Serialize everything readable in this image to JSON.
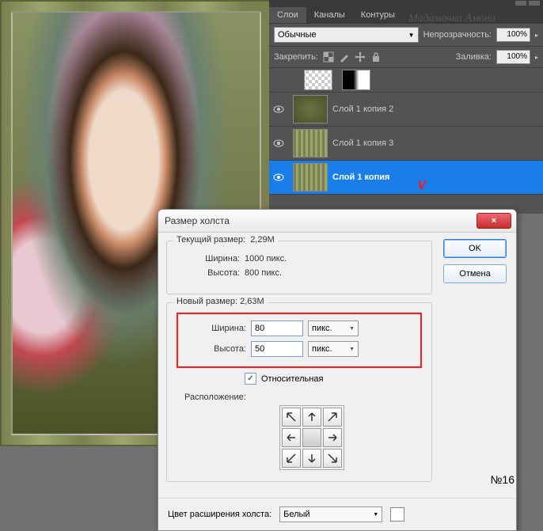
{
  "layers_panel": {
    "tabs": [
      "Слои",
      "Каналы",
      "Контуры"
    ],
    "blend_mode": "Обычные",
    "opacity_label": "Непрозрачность:",
    "opacity_value": "100%",
    "lock_label": "Закрепить:",
    "fill_label": "Заливка:",
    "fill_value": "100%",
    "layers": [
      {
        "name": "",
        "thumb": "checker"
      },
      {
        "name": "Слой 1 копия 2",
        "thumb": "stripes"
      },
      {
        "name": "Слой 1 копия 3",
        "thumb": "stripes"
      },
      {
        "name": "Слой 1 копия",
        "thumb": "stripes",
        "selected": true
      }
    ],
    "red_annotation": "V"
  },
  "dialog": {
    "title": "Размер холста",
    "close": "×",
    "current_group": "Текущий размер:",
    "current_size": "2,29M",
    "width_label": "Ширина:",
    "current_width": "1000 пикс.",
    "height_label": "Высота:",
    "current_height": "800 пикс.",
    "new_group": "Новый размер:",
    "new_size": "2,63M",
    "width_value": "80",
    "height_value": "50",
    "unit": "пикс.",
    "relative_label": "Относительная",
    "anchor_label": "Расположение:",
    "ok": "OK",
    "cancel": "Отмена",
    "ext_color_label": "Цвет расширения холста:",
    "ext_color_value": "Белый"
  },
  "watermark": "Мадамочка Амони",
  "page_number": "№16"
}
